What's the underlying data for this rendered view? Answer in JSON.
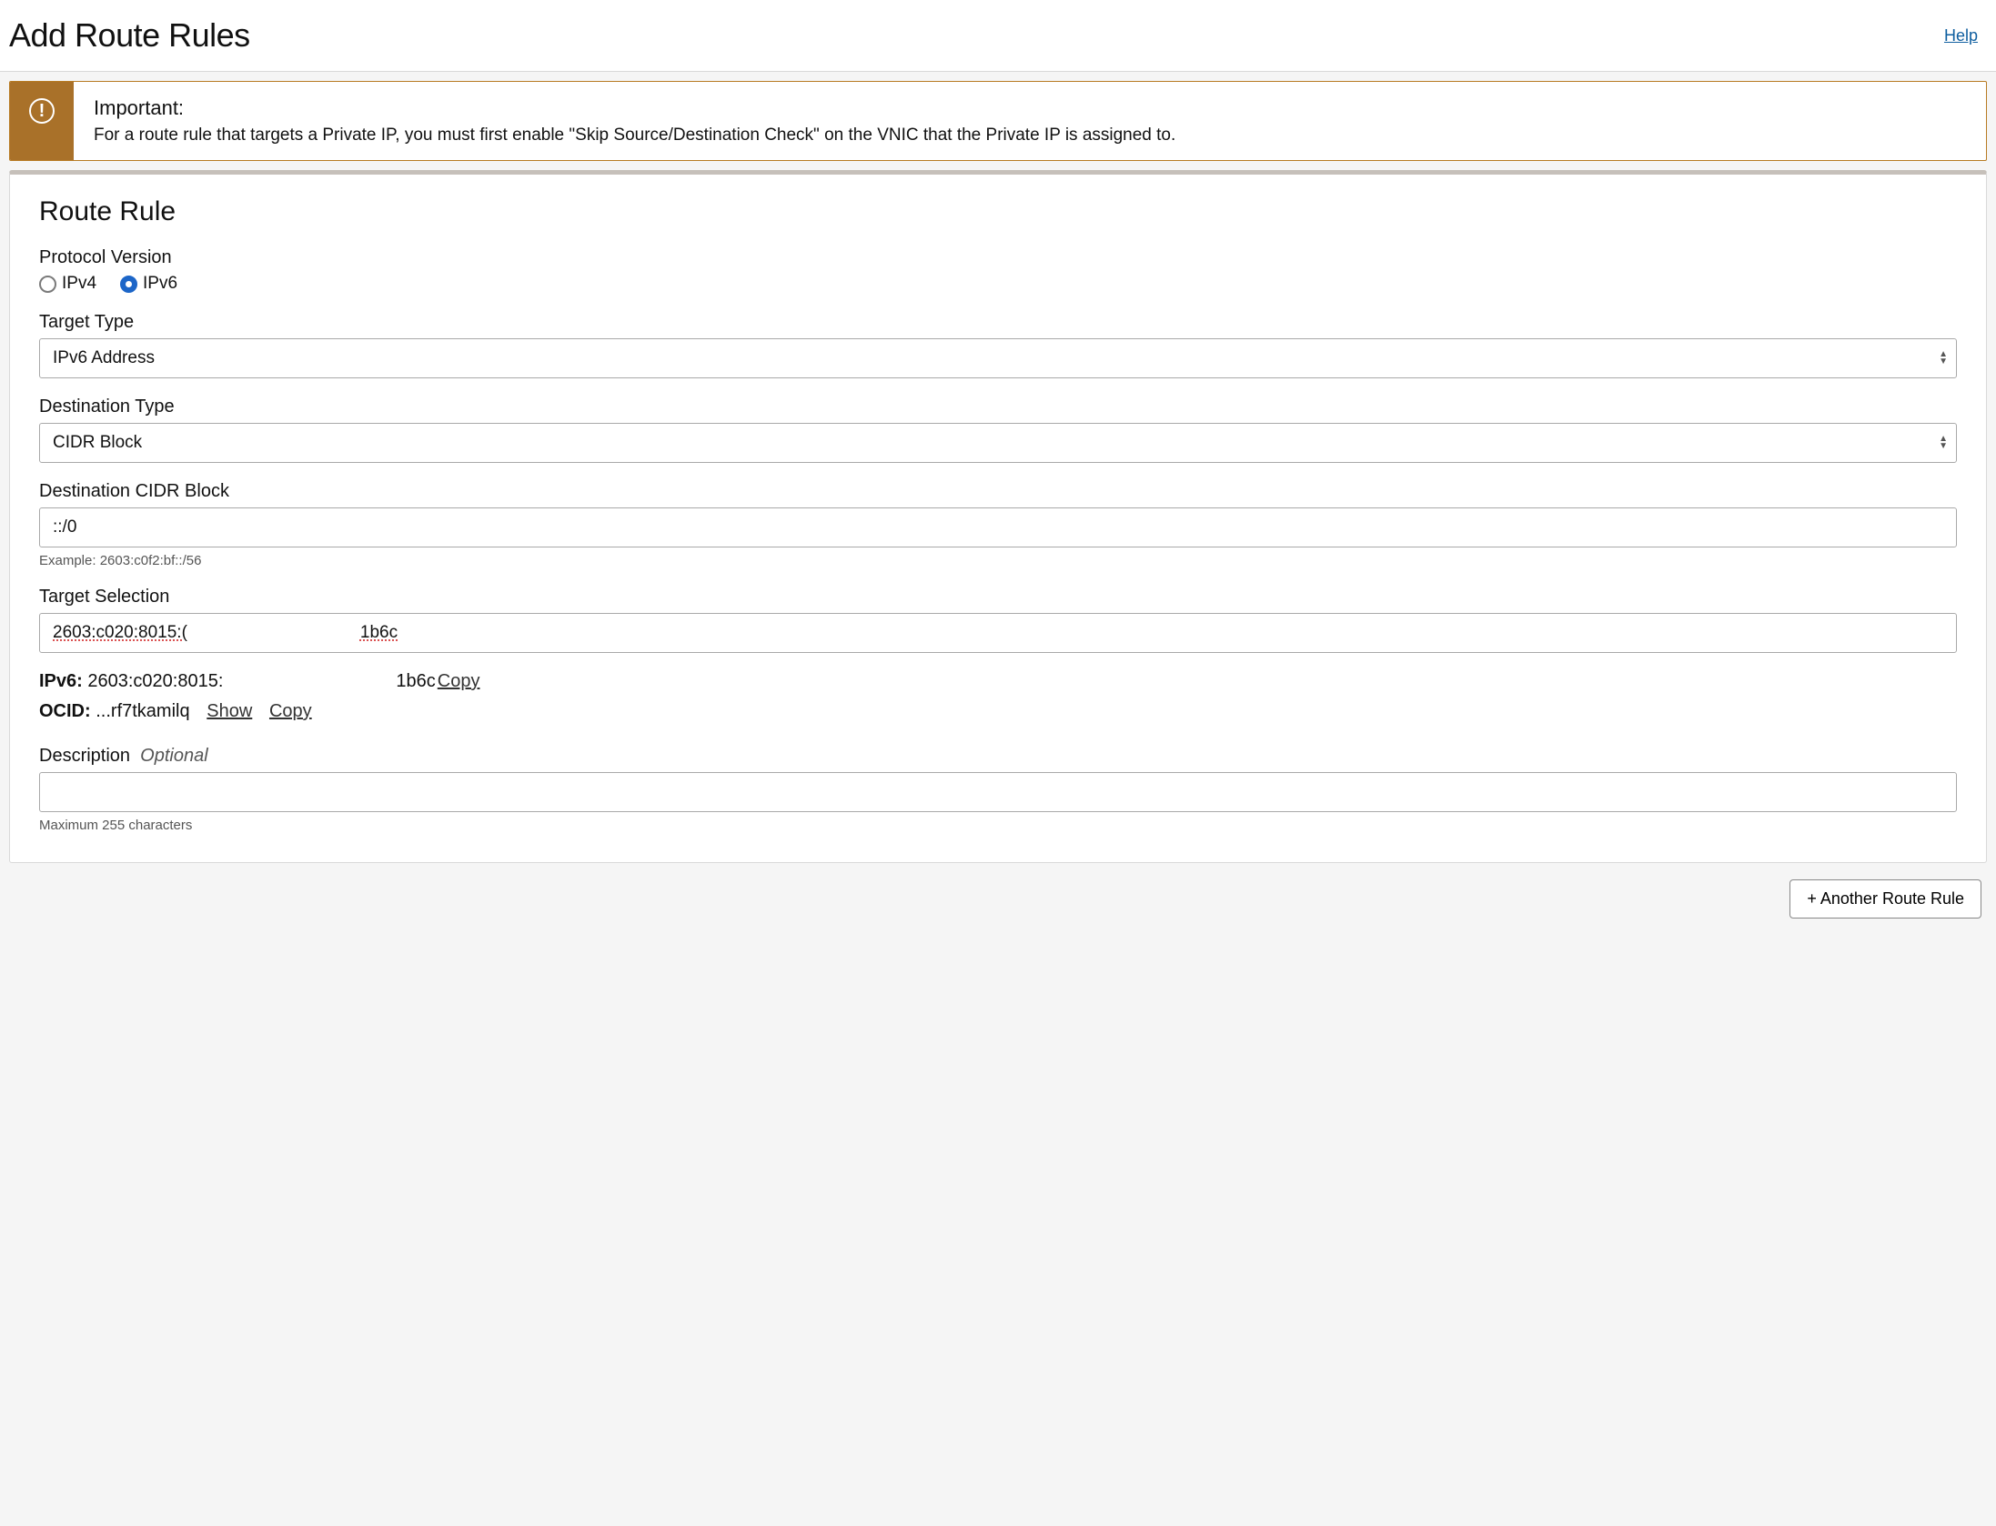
{
  "header": {
    "title": "Add Route Rules",
    "help": "Help"
  },
  "alert": {
    "title": "Important:",
    "text": "For a route rule that targets a Private IP, you must first enable \"Skip Source/Destination Check\" on the VNIC that the Private IP is assigned to."
  },
  "card": {
    "title": "Route Rule",
    "protocol": {
      "label": "Protocol Version",
      "options": {
        "ipv4": "IPv4",
        "ipv6": "IPv6"
      },
      "selected": "ipv6"
    },
    "targetType": {
      "label": "Target Type",
      "value": "IPv6 Address"
    },
    "destType": {
      "label": "Destination Type",
      "value": "CIDR Block"
    },
    "destCidr": {
      "label": "Destination CIDR Block",
      "value": "::/0",
      "example": "Example: 2603:c0f2:bf::/56"
    },
    "targetSel": {
      "label": "Target Selection",
      "part1": "2603:c020:8015:(",
      "part2": "1b6c"
    },
    "ipv6Line": {
      "label": "IPv6:",
      "part1": "2603:c020:8015:",
      "part2": "1b6c",
      "copy": "Copy"
    },
    "ocidLine": {
      "label": "OCID:",
      "value": "...rf7tkamilq",
      "show": "Show",
      "copy": "Copy"
    },
    "description": {
      "label": "Description",
      "optional": "Optional",
      "value": "",
      "helper": "Maximum 255 characters"
    }
  },
  "footer": {
    "addAnother": "+ Another Route Rule"
  }
}
